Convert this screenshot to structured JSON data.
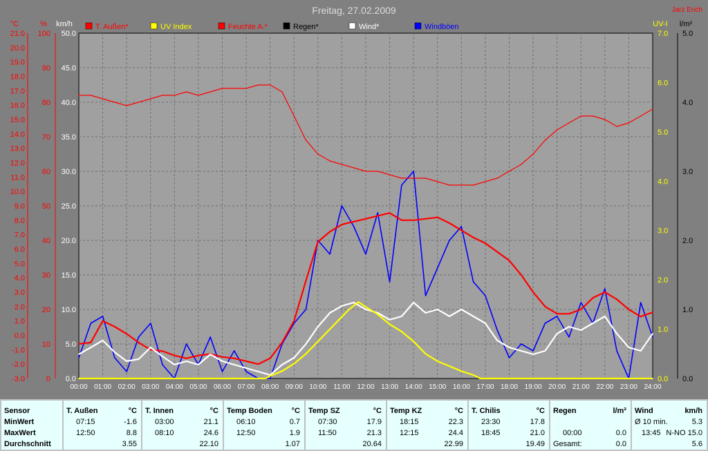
{
  "chart_data": {
    "type": "line",
    "title": "Freitag, 27.02.2009",
    "corner_label": "Jarz Erich",
    "axes": {
      "temp": {
        "unit": "°C",
        "ticks": [
          "21.0",
          "20.0",
          "19.0",
          "18.0",
          "17.0",
          "16.0",
          "15.0",
          "14.0",
          "13.0",
          "12.0",
          "11.0",
          "10.0",
          "9.0",
          "8.0",
          "7.0",
          "6.0",
          "5.0",
          "4.0",
          "3.0",
          "2.0",
          "1.0",
          "0.0",
          "-1.0",
          "-2.0",
          "-3.0"
        ],
        "range": [
          -3,
          21
        ]
      },
      "humidity": {
        "unit": "%",
        "ticks": [
          "100",
          "90",
          "80",
          "70",
          "60",
          "50",
          "40",
          "30",
          "20",
          "10",
          "0"
        ],
        "range": [
          0,
          100
        ]
      },
      "wind": {
        "unit": "km/h",
        "ticks": [
          "50.0",
          "45.0",
          "40.0",
          "35.0",
          "30.0",
          "25.0",
          "20.0",
          "15.0",
          "10.0",
          "5.0",
          "0.0"
        ],
        "range": [
          0,
          50
        ]
      },
      "uv": {
        "unit": "UV-I",
        "ticks": [
          "7.0",
          "6.0",
          "5.0",
          "4.0",
          "3.0",
          "2.0",
          "1.0",
          "0.0"
        ],
        "range": [
          0,
          7
        ]
      },
      "rain": {
        "unit": "l/m²",
        "ticks": [
          "5.0",
          "4.0",
          "3.0",
          "2.0",
          "1.0",
          "0.0"
        ],
        "range": [
          0,
          5
        ]
      }
    },
    "x_ticks": [
      "00:00",
      "01:00",
      "02:00",
      "03:00",
      "04:00",
      "05:00",
      "06:00",
      "07:00",
      "08:00",
      "09:00",
      "10:00",
      "11:00",
      "12:00",
      "13:00",
      "14:00",
      "15:00",
      "16:00",
      "17:00",
      "18:00",
      "19:00",
      "20:00",
      "21:00",
      "22:00",
      "23:00",
      "24:00"
    ],
    "grid": true,
    "legend_position": "top",
    "legend": [
      {
        "label": "T. Außen*",
        "color": "#ff0000"
      },
      {
        "label": "UV Index",
        "color": "#ffff00"
      },
      {
        "label": "Feuchte A.*",
        "color": "#ff0000"
      },
      {
        "label": "Regen*",
        "color": "#000000"
      },
      {
        "label": "Wind*",
        "color": "#ffffff"
      },
      {
        "label": "Windböen",
        "color": "#0000ff"
      }
    ],
    "series": [
      {
        "name": "T. Außen*",
        "axis": "temp",
        "color": "#ff0000",
        "x": [
          0,
          0.5,
          1,
          1.5,
          2,
          2.5,
          3,
          3.5,
          4,
          4.5,
          5,
          5.5,
          6,
          6.5,
          7,
          7.5,
          8,
          8.5,
          9,
          9.5,
          10,
          10.5,
          11,
          11.5,
          12,
          12.5,
          13,
          13.5,
          14,
          14.5,
          15,
          15.5,
          16,
          16.5,
          17,
          17.5,
          18,
          18.5,
          19,
          19.5,
          20,
          20.5,
          21,
          21.5,
          22,
          22.5,
          23,
          23.5,
          24
        ],
        "y": [
          -0.6,
          -0.5,
          1.0,
          0.6,
          0.1,
          -0.5,
          -1.0,
          -1.1,
          -1.4,
          -1.6,
          -1.4,
          -1.3,
          -1.5,
          -1.6,
          -1.8,
          -2.0,
          -1.6,
          -0.5,
          1.0,
          3.8,
          6.5,
          7.2,
          7.7,
          7.9,
          8.1,
          8.3,
          8.5,
          8.0,
          8.0,
          8.1,
          8.2,
          7.8,
          7.3,
          6.8,
          6.4,
          5.8,
          5.2,
          4.2,
          3.0,
          2.0,
          1.5,
          1.5,
          1.8,
          2.6,
          3.0,
          2.5,
          1.8,
          1.3,
          1.6
        ]
      },
      {
        "name": "Feuchte A.*",
        "axis": "humidity",
        "color": "#ff0000",
        "x": [
          0,
          0.5,
          1,
          1.5,
          2,
          2.5,
          3,
          3.5,
          4,
          4.5,
          5,
          5.5,
          6,
          6.5,
          7,
          7.5,
          8,
          8.5,
          9,
          9.5,
          10,
          10.5,
          11,
          11.5,
          12,
          12.5,
          13,
          13.5,
          14,
          14.5,
          15,
          15.5,
          16,
          16.5,
          17,
          17.5,
          18,
          18.5,
          19,
          19.5,
          20,
          20.5,
          21,
          21.5,
          22,
          22.5,
          23,
          23.5,
          24
        ],
        "y": [
          82,
          82,
          81,
          80,
          79,
          80,
          81,
          82,
          82,
          83,
          82,
          83,
          84,
          84,
          84,
          85,
          85,
          83,
          76,
          69,
          65,
          63,
          62,
          61,
          60,
          60,
          59,
          58,
          58,
          58,
          57,
          56,
          56,
          56,
          57,
          58,
          60,
          62,
          65,
          69,
          72,
          74,
          76,
          76,
          75,
          73,
          74,
          76,
          78
        ]
      },
      {
        "name": "UV Index",
        "axis": "uv",
        "color": "#ffff00",
        "x": [
          0,
          7.8,
          8.0,
          8.5,
          9.0,
          9.5,
          10.0,
          10.5,
          11.0,
          11.3,
          11.7,
          12.0,
          12.5,
          13.0,
          13.5,
          14.0,
          14.5,
          15.0,
          15.5,
          16.0,
          16.5,
          16.8,
          24
        ],
        "y": [
          0,
          0,
          0.05,
          0.15,
          0.3,
          0.5,
          0.75,
          1.0,
          1.25,
          1.4,
          1.55,
          1.45,
          1.3,
          1.1,
          0.95,
          0.75,
          0.5,
          0.35,
          0.25,
          0.15,
          0.07,
          0,
          0
        ]
      },
      {
        "name": "Wind*",
        "axis": "wind",
        "color": "#ffffff",
        "x": [
          0,
          0.5,
          1,
          1.5,
          2,
          2.5,
          3,
          3.5,
          4,
          4.5,
          5,
          5.5,
          6,
          6.5,
          7,
          7.5,
          8,
          8.5,
          9,
          9.5,
          10,
          10.5,
          11,
          11.5,
          12,
          12.5,
          13,
          13.5,
          14,
          14.5,
          15,
          15.5,
          16,
          16.5,
          17,
          17.5,
          18,
          18.5,
          19,
          19.5,
          20,
          20.5,
          21,
          21.5,
          22,
          22.5,
          23,
          23.5,
          24
        ],
        "y": [
          3.5,
          4.5,
          5.5,
          3.8,
          2.5,
          2.8,
          4.5,
          3.2,
          2.0,
          2.5,
          2.0,
          3.5,
          2.5,
          2.0,
          1.5,
          1.0,
          0.5,
          2.0,
          3.0,
          5.0,
          7.5,
          9.5,
          10.5,
          11.0,
          10.0,
          9.5,
          8.5,
          9.0,
          11.0,
          9.5,
          10.0,
          9.0,
          10.0,
          9.0,
          8.0,
          5.5,
          4.5,
          4.0,
          3.5,
          4.0,
          6.5,
          7.5,
          7.0,
          8.0,
          9.0,
          6.5,
          4.5,
          4.0,
          6.5
        ]
      },
      {
        "name": "Windböen",
        "axis": "wind",
        "color": "#0000ff",
        "x": [
          0,
          0.5,
          1,
          1.5,
          2,
          2.5,
          3,
          3.5,
          4,
          4.5,
          5,
          5.5,
          6,
          6.5,
          7,
          7.5,
          8,
          8.5,
          9,
          9.5,
          10,
          10.5,
          11,
          11.5,
          12,
          12.5,
          13,
          13.5,
          14,
          14.5,
          15,
          15.5,
          16,
          16.5,
          17,
          17.5,
          18,
          18.5,
          19,
          19.5,
          20,
          20.5,
          21,
          21.5,
          22,
          22.5,
          23,
          23.5,
          24
        ],
        "y": [
          3,
          8,
          9,
          3,
          1,
          6,
          8,
          2,
          0,
          5,
          2,
          6,
          1,
          4,
          1,
          0,
          0,
          5,
          8,
          10,
          20,
          18,
          25,
          22,
          18,
          24,
          14,
          28,
          30,
          12,
          16,
          20,
          22,
          14,
          12,
          7,
          3,
          5,
          4,
          8,
          9,
          6,
          11,
          8,
          13,
          4,
          0,
          11,
          6
        ]
      }
    ]
  },
  "stats": {
    "labels": {
      "sensor": "Sensor",
      "min": "MinWert",
      "max": "MaxWert",
      "avg": "Durchschnitt"
    },
    "columns": [
      {
        "title": "T. Außen",
        "unit": "°C",
        "min_time": "07:15",
        "min": "-1.6",
        "max_time": "12:50",
        "max": "8.8",
        "avg": "3.55"
      },
      {
        "title": "T. Innen",
        "unit": "°C",
        "min_time": "03:00",
        "min": "21.1",
        "max_time": "08:10",
        "max": "24.6",
        "avg": "22.10"
      },
      {
        "title": "Temp Boden",
        "unit": "°C",
        "min_time": "06:10",
        "min": "0.7",
        "max_time": "12:50",
        "max": "1.9",
        "avg": "1.07"
      },
      {
        "title": "Temp SZ",
        "unit": "°C",
        "min_time": "07:30",
        "min": "17.9",
        "max_time": "11:50",
        "max": "21.3",
        "avg": "20.64"
      },
      {
        "title": "Temp KZ",
        "unit": "°C",
        "min_time": "18:15",
        "min": "22.3",
        "max_time": "12:15",
        "max": "24.4",
        "avg": "22.99"
      },
      {
        "title": "T. Chilis",
        "unit": "°C",
        "min_time": "23:30",
        "min": "17.8",
        "max_time": "18:45",
        "max": "21.0",
        "avg": "19.49"
      }
    ],
    "regen": {
      "title": "Regen",
      "unit": "l/m²",
      "r1_label": "00:00",
      "r1_value": "0.0",
      "r2_label": "Gesamt:",
      "r2_value": "0.0"
    },
    "wind": {
      "title": "Wind",
      "unit": "km/h",
      "r1_label": "Ø 10 min.",
      "r1_value": "5.3",
      "r2_time": "13:45",
      "r2_dir": "N-NO 15.0",
      "r3_value": "5.6"
    }
  }
}
